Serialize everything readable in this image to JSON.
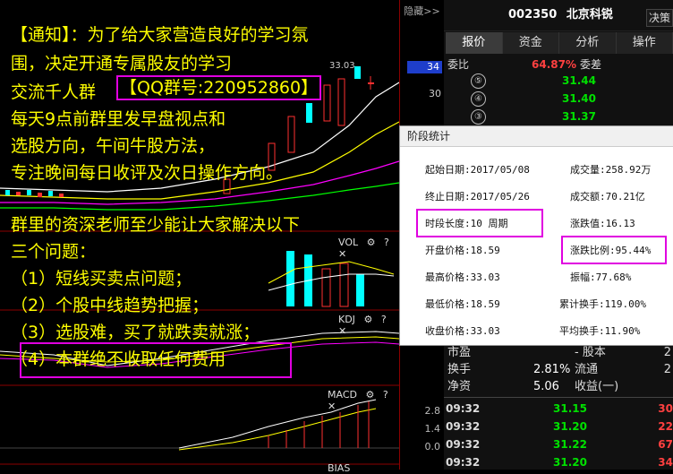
{
  "header": {
    "hide_label": "隐藏>>",
    "stock_code": "002350",
    "stock_name": "北京科锐",
    "decide_label": "决策"
  },
  "tabs": [
    "报价",
    "资金",
    "分析",
    "操作"
  ],
  "axis": {
    "price_box": "34",
    "price_30": "30",
    "lower": [
      "2.8",
      "1.4",
      "0.0"
    ]
  },
  "chart": {
    "date_label": "33.03",
    "vol_label": "VOL",
    "kdj_label": "KDJ",
    "macd_label": "MACD",
    "bias_label": "BIAS"
  },
  "orderbook": {
    "weibi_label": "委比",
    "weibi_value": "64.87%",
    "weicha_label": "委差",
    "sells": [
      {
        "idx": "⑤",
        "price": "31.44"
      },
      {
        "idx": "④",
        "price": "31.40"
      },
      {
        "idx": "③",
        "price": "31.37"
      }
    ]
  },
  "info": [
    {
      "l": "市盈",
      "m": "",
      "r": "- 股本",
      "r2": "2"
    },
    {
      "l": "换手",
      "m": "2.81%",
      "r": "流通",
      "r2": "2"
    },
    {
      "l": "净资",
      "m": "5.06",
      "r": "收益(一)",
      "r2": ""
    }
  ],
  "trades": [
    {
      "t": "09:32",
      "p": "31.15",
      "q": "30"
    },
    {
      "t": "09:32",
      "p": "31.20",
      "q": "22"
    },
    {
      "t": "09:32",
      "p": "31.22",
      "q": "67"
    },
    {
      "t": "09:32",
      "p": "31.20",
      "q": "34"
    }
  ],
  "dialog": {
    "title": "阶段统计",
    "rows": [
      [
        "起始日期:2017/05/08",
        "成交量:258.92万"
      ],
      [
        "终止日期:2017/05/26",
        "成交额:70.21亿"
      ],
      [
        "时段长度:10 周期",
        "涨跌值:16.13"
      ],
      [
        "开盘价格:18.59",
        "涨跌比例:95.44%"
      ],
      [
        "最高价格:33.03",
        "振幅:77.68%"
      ],
      [
        "最低价格:18.59",
        "累计换手:119.00%"
      ],
      [
        "收盘价格:33.03",
        "平均换手:11.90%"
      ]
    ]
  },
  "notice": {
    "lines": [
      "【通知】：为了给大家营造良好的学习氛",
      "围，决定开通专属股友的学习",
      "交流千人群",
      "每天9点前群里发早盘视点和",
      "选股方向，午间牛股方法，",
      "专注晚间每日收评及次日操作方向。",
      "群里的资深老师至少能让大家解决以下",
      "三个问题：",
      "（1）短线买卖点问题；",
      "（2）个股中线趋势把握；",
      "（3）选股难，买了就跌卖就涨；",
      "（4）本群绝不收取任何费用"
    ],
    "qq": "【QQ群号:220952860】"
  }
}
